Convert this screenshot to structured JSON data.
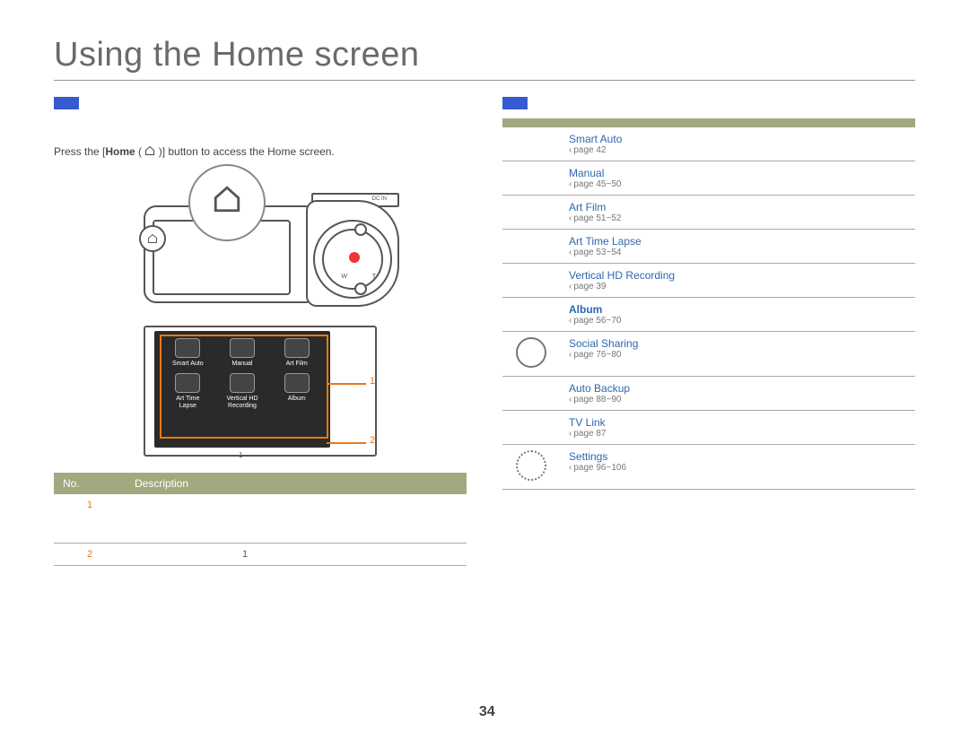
{
  "page": {
    "title": "Using the Home screen",
    "chapter_label": "",
    "page_number": "34"
  },
  "left": {
    "intro_line1": "",
    "intro_line2": "",
    "instruction_prefix": "Press the [",
    "instruction_home": "Home",
    "instruction_paren_open": " ( ",
    "instruction_paren_close": " )] button to access the Home screen.",
    "dcin_label": "DC IN",
    "zoom_w": "W",
    "zoom_t": "T",
    "apps": {
      "smart_auto": "Smart Auto",
      "manual": "Manual",
      "art_film": "Art Film",
      "art_time_lapse": "Art Time\nLapse",
      "vertical_hd": "Vertical HD\nRecording",
      "album": "Album"
    },
    "screen_page_dot": "1",
    "callout1": "1",
    "callout2": "2",
    "table": {
      "headers": {
        "no": "No.",
        "desc": "Description"
      },
      "rows": [
        {
          "no": "1",
          "desc": ""
        },
        {
          "no": "2",
          "desc_prefix": "",
          "desc_page": "1"
        }
      ]
    }
  },
  "right": {
    "menu_table": {
      "headers": {
        "icon": "",
        "desc": ""
      },
      "items": [
        {
          "name": "Smart Auto",
          "desc": "",
          "page": "42"
        },
        {
          "name": "Manual",
          "desc": "",
          "page": "45~50"
        },
        {
          "name": "Art Film",
          "desc": "",
          "page": "51~52"
        },
        {
          "name": "Art Time Lapse",
          "desc": "",
          "page": "53~54"
        },
        {
          "name": "Vertical HD Recording",
          "desc": "",
          "page": "39"
        },
        {
          "name": "Album",
          "desc": "",
          "page": "56~70",
          "bold": true
        },
        {
          "name": "Social Sharing",
          "desc": "",
          "page": "76~80",
          "icon": "round"
        },
        {
          "name": "Auto Backup",
          "desc": "",
          "page": "88~90"
        },
        {
          "name": "TV Link",
          "desc": "",
          "page": "87"
        },
        {
          "name": "Settings",
          "desc": "",
          "page": "96~106",
          "icon": "gear"
        }
      ]
    }
  }
}
